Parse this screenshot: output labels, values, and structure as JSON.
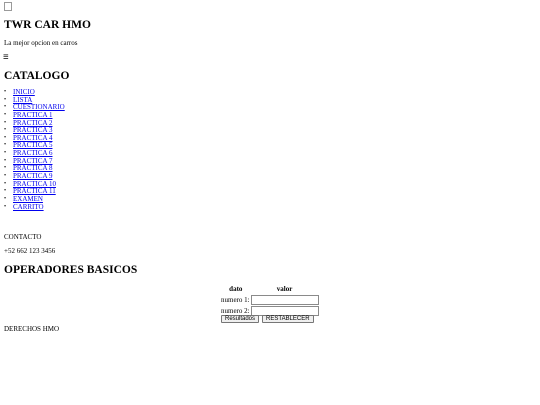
{
  "header": {
    "title": "TWR CAR HMO",
    "tagline": "La mejor opcion en carros",
    "menu_icon": "≡"
  },
  "catalog": {
    "title": "CATALOGO",
    "items": [
      "INICIO",
      "LISTA",
      "CUESTIONARIO",
      "PRACTICA 1",
      "PRACTICA 2",
      "PRACTICA 3",
      "PRACTICA 4",
      "PRACTICA 5",
      "PRACTICA 6",
      "PRACTICA 7",
      "PRACTICA 8",
      "PRACTICA 9",
      "PRACTICA 10",
      "PRACTICA 11",
      "EXAMEN",
      "CARRITO"
    ]
  },
  "contact": {
    "label": "CONTACTO",
    "phone": "+52 662 123 3456"
  },
  "operators": {
    "title": "OPERADORES BASICOS",
    "col_dato": "dato",
    "col_valor": "valor",
    "label_1": "numero 1:",
    "label_2": "numero 2:",
    "value_1": "",
    "value_2": "",
    "results_button": "Resultados",
    "reset_button": "RESTABLECER"
  },
  "footer": {
    "text": "DERECHOS HMO"
  }
}
